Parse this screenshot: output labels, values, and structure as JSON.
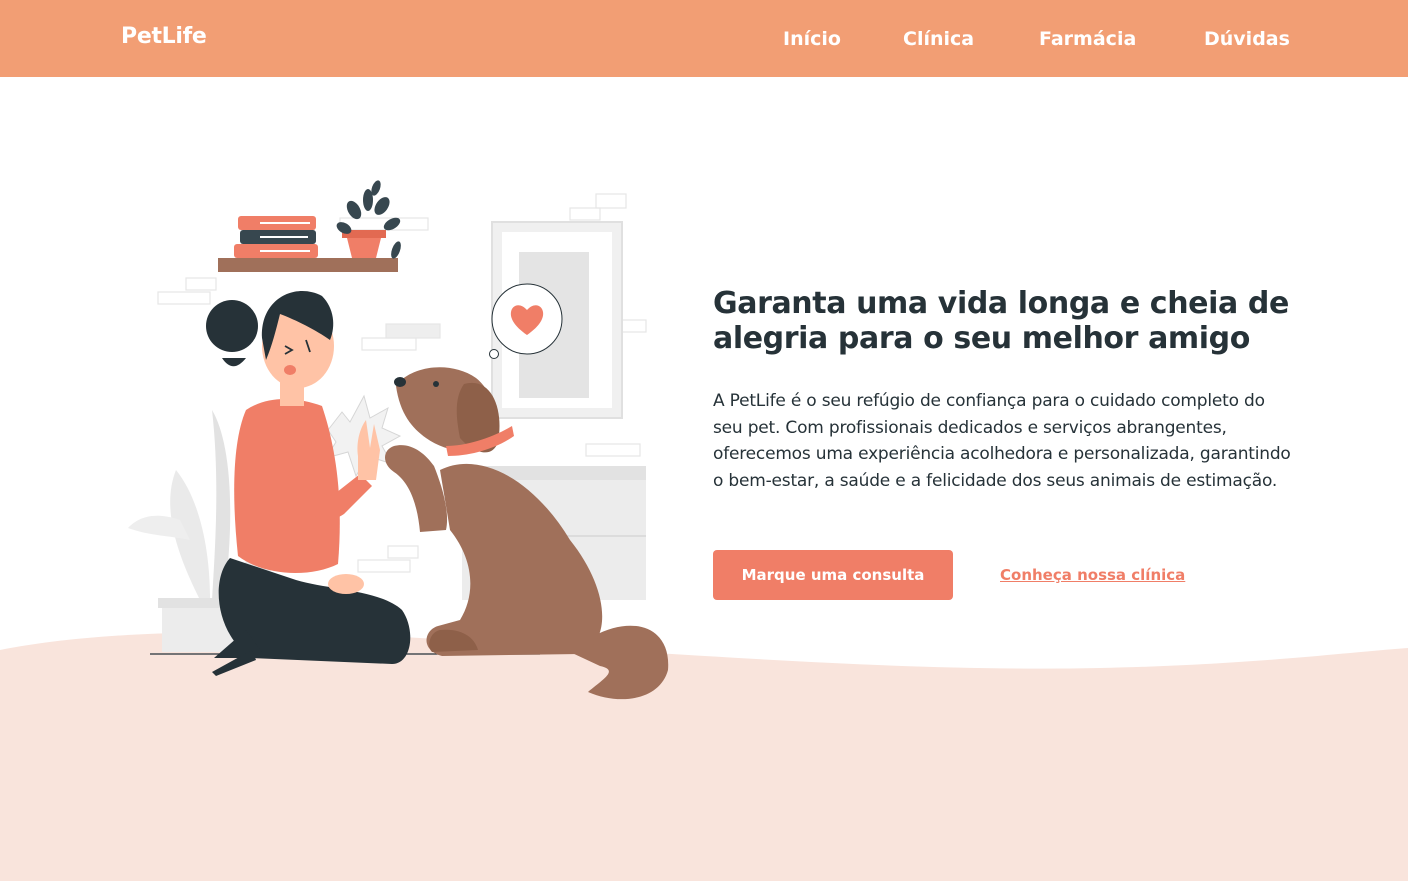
{
  "header": {
    "logo": "PetLife",
    "nav": [
      {
        "label": "Início"
      },
      {
        "label": "Clínica"
      },
      {
        "label": "Farmácia"
      },
      {
        "label": "Dúvidas"
      }
    ]
  },
  "hero": {
    "title": "Garanta uma vida longa e cheia de alegria para o seu melhor amigo",
    "text": "A PetLife é o seu refúgio de confiança para o cuidado completo do seu pet. Com profissionais dedicados e serviços abrangentes, oferecemos uma experiência acolhedora e personalizada, garantindo o bem-estar, a saúde e a felicidade dos seus animais de estimação.",
    "primary_button": "Marque uma consulta",
    "secondary_link": "Conheça nossa clínica"
  },
  "colors": {
    "header_bg": "#f29e74",
    "accent": "#f07e67",
    "dark_text": "#263238",
    "floor_bg": "#f9e4dc",
    "dog_brown": "#a0705a"
  },
  "illustration": {
    "icons": [
      "woman-figure",
      "dog-figure",
      "heart-icon",
      "bookshelf",
      "potted-plant",
      "picture-frame"
    ]
  }
}
